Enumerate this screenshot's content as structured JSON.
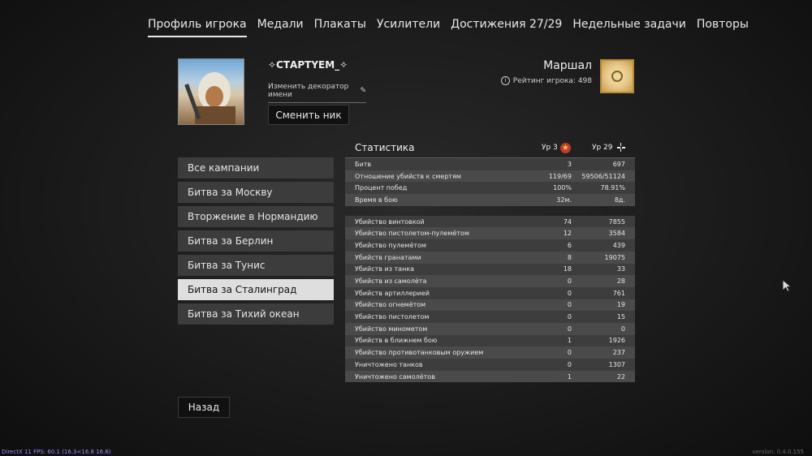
{
  "tabs": [
    {
      "label": "Профиль игрока",
      "active": true
    },
    {
      "label": "Медали"
    },
    {
      "label": "Плакаты"
    },
    {
      "label": "Усилители"
    },
    {
      "label": "Достижения 27/29"
    },
    {
      "label": "Недельные задачи"
    },
    {
      "label": "Повторы"
    }
  ],
  "profile": {
    "nickname": "✧СТАРТYЕМ_✧",
    "decorator_label": "Изменить декоратор имени",
    "change_nick_button": "Сменить ник",
    "rank": "Маршал",
    "rating": "Рейтинг игрока: 498"
  },
  "campaigns": [
    {
      "label": "Все кампании"
    },
    {
      "label": "Битва за Москву"
    },
    {
      "label": "Вторжение в Нормандию"
    },
    {
      "label": "Битва за Берлин"
    },
    {
      "label": "Битва за Тунис"
    },
    {
      "label": "Битва за Сталинград",
      "active": true
    },
    {
      "label": "Битва за Тихий океан"
    }
  ],
  "back_button": "Назад",
  "stats": {
    "title": "Статистика",
    "col1": "Ур 3",
    "col2": "Ур 29",
    "general": [
      {
        "label": "Битв",
        "v1": "3",
        "v2": "697"
      },
      {
        "label": "Отношение убийств к смертям",
        "v1": "119/69",
        "v2": "59506/51124"
      },
      {
        "label": "Процент побед",
        "v1": "100%",
        "v2": "78.91%"
      },
      {
        "label": "Время в бою",
        "v1": "32м.",
        "v2": "8д."
      }
    ],
    "kills": [
      {
        "label": "Убийство винтовкой",
        "v1": "74",
        "v2": "7855"
      },
      {
        "label": "Убийство пистолетом-пулемётом",
        "v1": "12",
        "v2": "3584"
      },
      {
        "label": "Убийство пулемётом",
        "v1": "6",
        "v2": "439"
      },
      {
        "label": "Убийств гранатами",
        "v1": "8",
        "v2": "19075"
      },
      {
        "label": "Убийств из танка",
        "v1": "18",
        "v2": "33"
      },
      {
        "label": "Убийств из самолёта",
        "v1": "0",
        "v2": "28"
      },
      {
        "label": "Убийств артиллерией",
        "v1": "0",
        "v2": "761"
      },
      {
        "label": "Убийство огнемётом",
        "v1": "0",
        "v2": "19"
      },
      {
        "label": "Убийство пистолетом",
        "v1": "0",
        "v2": "15"
      },
      {
        "label": "Убийство минометом",
        "v1": "0",
        "v2": "0"
      },
      {
        "label": "Убийств в ближнем бою",
        "v1": "1",
        "v2": "1926"
      },
      {
        "label": "Убийство противотанковым оружием",
        "v1": "0",
        "v2": "237"
      },
      {
        "label": "Уничтожено танков",
        "v1": "0",
        "v2": "1307"
      },
      {
        "label": "Уничтожено самолётов",
        "v1": "1",
        "v2": "22"
      }
    ]
  },
  "footer": {
    "fps": "DirectX 11 FPS: 60.1 (16.3<16.8 16.6)",
    "version": "version: 0.4.0.155"
  }
}
